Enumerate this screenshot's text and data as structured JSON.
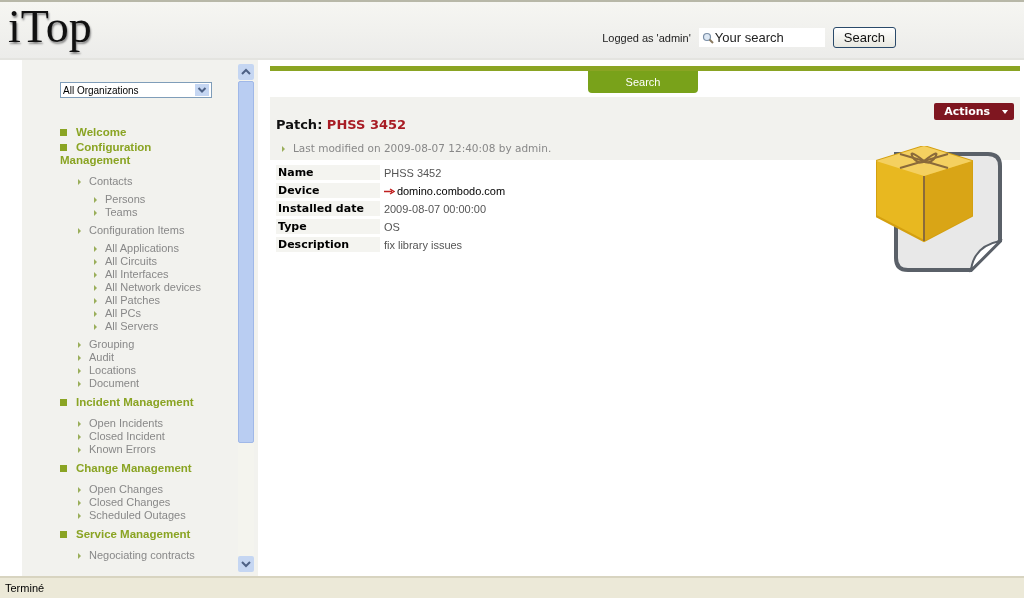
{
  "header": {
    "logo": "iTop",
    "logged_as": "Logged as 'admin'",
    "search": {
      "placeholder": "Your search"
    },
    "search_button": "Search"
  },
  "sidebar": {
    "organization": "All Organizations",
    "menu": [
      {
        "label": "Welcome"
      },
      {
        "label": "Configuration Management",
        "children": [
          {
            "label": "Contacts",
            "children": [
              {
                "label": "Persons"
              },
              {
                "label": "Teams"
              }
            ]
          },
          {
            "label": "Configuration Items",
            "children": [
              {
                "label": "All Applications"
              },
              {
                "label": "All Circuits"
              },
              {
                "label": "All Interfaces"
              },
              {
                "label": "All Network devices"
              },
              {
                "label": "All Patches"
              },
              {
                "label": "All PCs"
              },
              {
                "label": "All Servers"
              }
            ]
          },
          {
            "label": "Grouping"
          },
          {
            "label": "Audit"
          },
          {
            "label": "Locations"
          },
          {
            "label": "Document"
          }
        ]
      },
      {
        "label": "Incident Management",
        "children": [
          {
            "label": "Open Incidents"
          },
          {
            "label": "Closed Incident"
          },
          {
            "label": "Known Errors"
          }
        ]
      },
      {
        "label": "Change Management",
        "children": [
          {
            "label": "Open Changes"
          },
          {
            "label": "Closed Changes"
          },
          {
            "label": "Scheduled Outages"
          }
        ]
      },
      {
        "label": "Service Management",
        "children": [
          {
            "label": "Negociating contracts"
          }
        ]
      }
    ]
  },
  "search_tab": "Search",
  "object": {
    "class_label": "Patch:",
    "name": "PHSS 3452",
    "actions": "Actions",
    "last_modified": "Last modified on 2009-08-07 12:40:08 by admin.",
    "fields": [
      {
        "label": "Name",
        "value": "PHSS 3452",
        "kind": "text"
      },
      {
        "label": "Device",
        "value": "domino.combodo.com",
        "kind": "link"
      },
      {
        "label": "Installed date",
        "value": "2009-08-07 00:00:00",
        "kind": "text"
      },
      {
        "label": "Type",
        "value": "OS",
        "kind": "text"
      },
      {
        "label": "Description",
        "value": "fix library issues",
        "kind": "text"
      }
    ]
  },
  "status_bar": "Terminé"
}
